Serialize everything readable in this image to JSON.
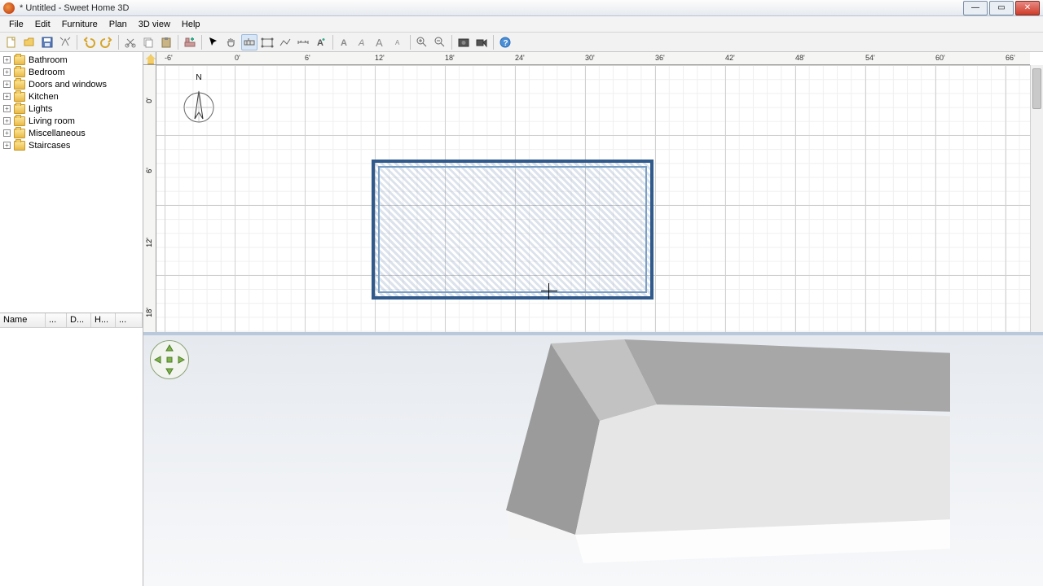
{
  "window": {
    "title": "* Untitled - Sweet Home 3D"
  },
  "menu": {
    "file": "File",
    "edit": "Edit",
    "furniture": "Furniture",
    "plan": "Plan",
    "view3d": "3D view",
    "help": "Help"
  },
  "catalog": {
    "items": [
      {
        "label": "Bathroom"
      },
      {
        "label": "Bedroom"
      },
      {
        "label": "Doors and windows"
      },
      {
        "label": "Kitchen"
      },
      {
        "label": "Lights"
      },
      {
        "label": "Living room"
      },
      {
        "label": "Miscellaneous"
      },
      {
        "label": "Staircases"
      }
    ]
  },
  "furniture_table": {
    "cols": [
      "Name",
      "...",
      "D...",
      "H...",
      "..."
    ]
  },
  "ruler": {
    "h_ticks": [
      {
        "pos": 10,
        "label": "-6'"
      },
      {
        "pos": 96,
        "label": "0'"
      },
      {
        "pos": 182,
        "label": "6'"
      },
      {
        "pos": 268,
        "label": "12'"
      },
      {
        "pos": 354,
        "label": "18'"
      },
      {
        "pos": 440,
        "label": "24'"
      },
      {
        "pos": 526,
        "label": "30'"
      },
      {
        "pos": 612,
        "label": "36'"
      },
      {
        "pos": 698,
        "label": "42'"
      },
      {
        "pos": 784,
        "label": "48'"
      },
      {
        "pos": 870,
        "label": "54'"
      },
      {
        "pos": 956,
        "label": "60'"
      },
      {
        "pos": 1042,
        "label": "66'"
      }
    ],
    "v_ticks": [
      {
        "pos": 40,
        "label": "0'"
      },
      {
        "pos": 126,
        "label": "6'"
      },
      {
        "pos": 212,
        "label": "12'"
      },
      {
        "pos": 298,
        "label": "18'"
      }
    ],
    "compass_label": "N"
  }
}
